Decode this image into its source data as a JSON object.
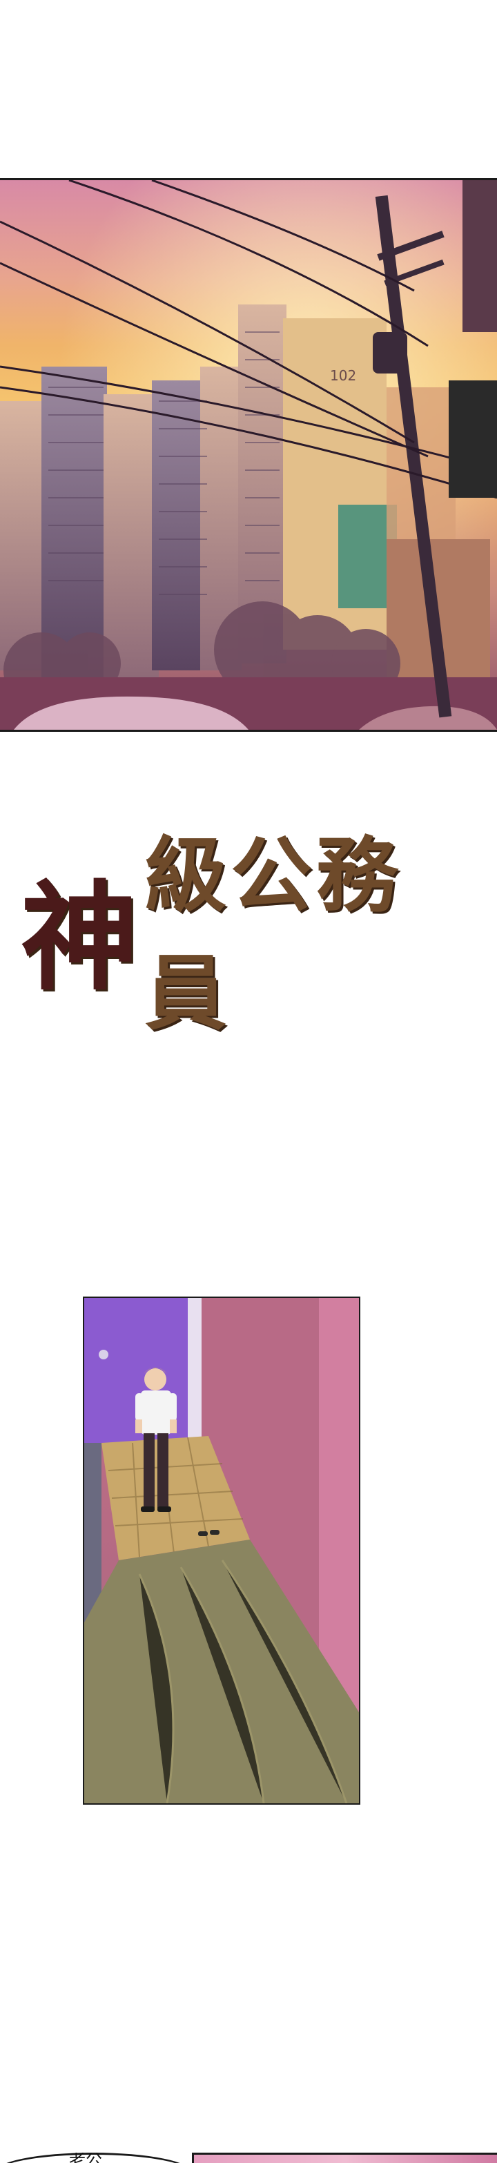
{
  "title": {
    "first_char": "神",
    "rest": "級公務員"
  },
  "speech_bubble": {
    "text": "老公"
  },
  "panels": {
    "city": {
      "scene": "apartments-sunset",
      "building_number": "102"
    },
    "hallway": {
      "scene": "hallway-man-standing"
    }
  },
  "colors": {
    "title_brown": "#6e4a2a",
    "title_dark": "#4b1a1a",
    "sky_pink": "#d88aa6",
    "sky_orange": "#f0b46a",
    "door_purple": "#8b5bd0",
    "wall_pink": "#c46f86"
  }
}
